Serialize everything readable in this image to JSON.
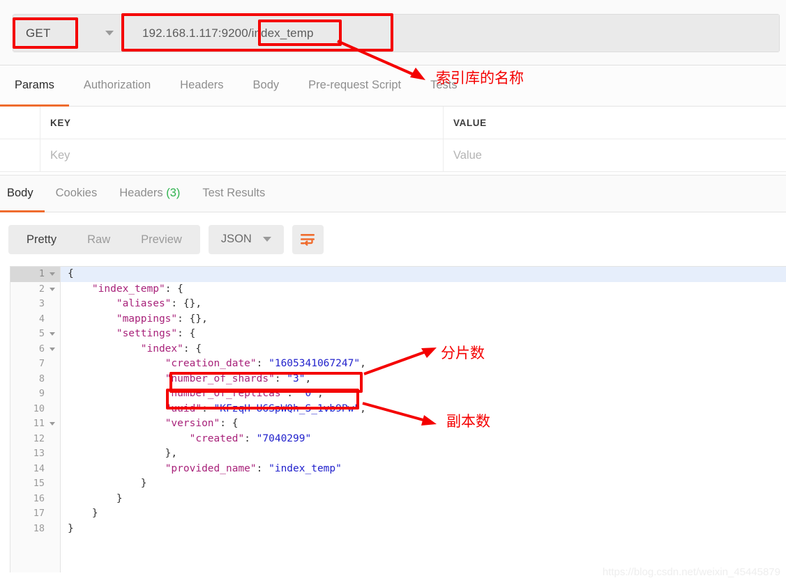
{
  "request": {
    "method": "GET",
    "url": "192.168.1.117:9200/index_temp",
    "url_prefix": "192.168.1.117:9200",
    "url_suffix": "/index_temp",
    "tabs": [
      {
        "label": "Params",
        "active": true
      },
      {
        "label": "Authorization",
        "active": false
      },
      {
        "label": "Headers",
        "active": false
      },
      {
        "label": "Body",
        "active": false
      },
      {
        "label": "Pre-request Script",
        "active": false
      },
      {
        "label": "Tests",
        "active": false
      }
    ]
  },
  "params_table": {
    "headers": [
      "KEY",
      "VALUE"
    ],
    "placeholder_key": "Key",
    "placeholder_value": "Value"
  },
  "response": {
    "tabs": [
      {
        "label": "Body",
        "active": true
      },
      {
        "label": "Cookies",
        "active": false
      },
      {
        "label": "Headers",
        "active": false,
        "count": "(3)"
      },
      {
        "label": "Test Results",
        "active": false
      }
    ],
    "view_modes": [
      {
        "label": "Pretty",
        "active": true
      },
      {
        "label": "Raw",
        "active": false
      },
      {
        "label": "Preview",
        "active": false
      }
    ],
    "format": "JSON",
    "wrap_icon": "word-wrap-icon"
  },
  "code": {
    "total_lines": 18,
    "active_line": 1,
    "fold_lines": [
      1,
      2,
      5,
      6,
      11
    ],
    "lines": [
      {
        "n": 1,
        "tokens": [
          {
            "t": "p",
            "v": "{"
          }
        ]
      },
      {
        "n": 2,
        "tokens": [
          {
            "t": "p",
            "v": "    "
          },
          {
            "t": "k",
            "v": "\"index_temp\""
          },
          {
            "t": "p",
            "v": ": {"
          }
        ]
      },
      {
        "n": 3,
        "tokens": [
          {
            "t": "p",
            "v": "        "
          },
          {
            "t": "k",
            "v": "\"aliases\""
          },
          {
            "t": "p",
            "v": ": {},"
          }
        ]
      },
      {
        "n": 4,
        "tokens": [
          {
            "t": "p",
            "v": "        "
          },
          {
            "t": "k",
            "v": "\"mappings\""
          },
          {
            "t": "p",
            "v": ": {},"
          }
        ]
      },
      {
        "n": 5,
        "tokens": [
          {
            "t": "p",
            "v": "        "
          },
          {
            "t": "k",
            "v": "\"settings\""
          },
          {
            "t": "p",
            "v": ": {"
          }
        ]
      },
      {
        "n": 6,
        "tokens": [
          {
            "t": "p",
            "v": "            "
          },
          {
            "t": "k",
            "v": "\"index\""
          },
          {
            "t": "p",
            "v": ": {"
          }
        ]
      },
      {
        "n": 7,
        "tokens": [
          {
            "t": "p",
            "v": "                "
          },
          {
            "t": "k",
            "v": "\"creation_date\""
          },
          {
            "t": "p",
            "v": ": "
          },
          {
            "t": "s",
            "v": "\"1605341067247\""
          },
          {
            "t": "p",
            "v": ","
          }
        ]
      },
      {
        "n": 8,
        "tokens": [
          {
            "t": "p",
            "v": "                "
          },
          {
            "t": "k",
            "v": "\"number_of_shards\""
          },
          {
            "t": "p",
            "v": ": "
          },
          {
            "t": "s",
            "v": "\"3\""
          },
          {
            "t": "p",
            "v": ","
          }
        ]
      },
      {
        "n": 9,
        "tokens": [
          {
            "t": "p",
            "v": "                "
          },
          {
            "t": "k",
            "v": "\"number_of_replicas\""
          },
          {
            "t": "p",
            "v": ": "
          },
          {
            "t": "s",
            "v": "\"0\""
          },
          {
            "t": "p",
            "v": ","
          }
        ]
      },
      {
        "n": 10,
        "tokens": [
          {
            "t": "p",
            "v": "                "
          },
          {
            "t": "k",
            "v": "\"uuid\""
          },
          {
            "t": "p",
            "v": ": "
          },
          {
            "t": "s",
            "v": "\"KFzqH-U6SpWQh_S_1vb9Pw\""
          },
          {
            "t": "p",
            "v": ","
          }
        ]
      },
      {
        "n": 11,
        "tokens": [
          {
            "t": "p",
            "v": "                "
          },
          {
            "t": "k",
            "v": "\"version\""
          },
          {
            "t": "p",
            "v": ": {"
          }
        ]
      },
      {
        "n": 12,
        "tokens": [
          {
            "t": "p",
            "v": "                    "
          },
          {
            "t": "k",
            "v": "\"created\""
          },
          {
            "t": "p",
            "v": ": "
          },
          {
            "t": "s",
            "v": "\"7040299\""
          }
        ]
      },
      {
        "n": 13,
        "tokens": [
          {
            "t": "p",
            "v": "                },"
          }
        ]
      },
      {
        "n": 14,
        "tokens": [
          {
            "t": "p",
            "v": "                "
          },
          {
            "t": "k",
            "v": "\"provided_name\""
          },
          {
            "t": "p",
            "v": ": "
          },
          {
            "t": "s",
            "v": "\"index_temp\""
          }
        ]
      },
      {
        "n": 15,
        "tokens": [
          {
            "t": "p",
            "v": "            }"
          }
        ]
      },
      {
        "n": 16,
        "tokens": [
          {
            "t": "p",
            "v": "        }"
          }
        ]
      },
      {
        "n": 17,
        "tokens": [
          {
            "t": "p",
            "v": "    }"
          }
        ]
      },
      {
        "n": 18,
        "tokens": [
          {
            "t": "p",
            "v": "}"
          }
        ]
      }
    ]
  },
  "annotations": {
    "color": "#f40000",
    "labels": [
      {
        "id": "index-name",
        "text": "索引库的名称"
      },
      {
        "id": "shard-count",
        "text": "分片数"
      },
      {
        "id": "replica-count",
        "text": "副本数"
      }
    ]
  },
  "watermark": "https://blog.csdn.net/weixin_45445879"
}
